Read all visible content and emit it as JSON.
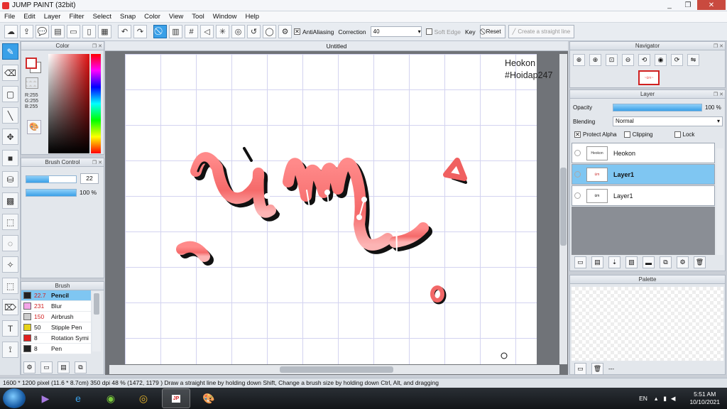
{
  "window": {
    "title": "JUMP PAINT (32bit)",
    "min": "_",
    "max": "❐",
    "close": "✕"
  },
  "menu": [
    "File",
    "Edit",
    "Layer",
    "Filter",
    "Select",
    "Snap",
    "Color",
    "View",
    "Tool",
    "Window",
    "Help"
  ],
  "toolbar": {
    "antialiasing_label": "AntiAliasing",
    "correction_label": "Correction",
    "correction_value": "40",
    "soft_edge_label": "Soft Edge",
    "key_label": "Key",
    "reset_label": "Reset",
    "straight_line_label": "Create a straight line"
  },
  "color_panel": {
    "title": "Color",
    "r": "R:255",
    "g": "G:255",
    "b": "B:255",
    "fg_color": "#d02a2a"
  },
  "brush_control": {
    "title": "Brush Control",
    "size": "22",
    "size_fill": 0.45,
    "opacity": "100 %",
    "opacity_fill": 1.0
  },
  "brush_panel": {
    "title": "Brush",
    "items": [
      {
        "size": "22.7",
        "name": "Pencil",
        "color": "#222222",
        "selected": true
      },
      {
        "size": "231",
        "name": "Blur",
        "color": "#f4a6e8",
        "selected": false
      },
      {
        "size": "150",
        "name": "Airbrush",
        "color": "#cccccc",
        "selected": false
      },
      {
        "size": "50",
        "name": "Stipple Pen",
        "color": "#e6d21a",
        "selected": false
      },
      {
        "size": "8",
        "name": "Rotation Symi",
        "color": "#e02020",
        "selected": false
      },
      {
        "size": "8",
        "name": "Pen",
        "color": "#222222",
        "selected": false
      }
    ]
  },
  "canvas": {
    "tab": "Untitled",
    "credit_line1": "Heokon",
    "credit_line2": "#Hoidap247"
  },
  "navigator": {
    "title": "Navigator"
  },
  "layer_panel": {
    "title": "Layer",
    "opacity_label": "Opacity",
    "opacity_value": "100 %",
    "opacity_fill": 1.0,
    "blending_label": "Blending",
    "blending_value": "Normal",
    "protect_alpha": "Protect Alpha",
    "clipping": "Clipping",
    "lock": "Lock",
    "layers": [
      {
        "name": "Heokon",
        "selected": false,
        "bold": false
      },
      {
        "name": "Layer1",
        "selected": true,
        "bold": true
      },
      {
        "name": "Layer1",
        "selected": false,
        "bold": false
      }
    ]
  },
  "palette_panel": {
    "title": "Palette",
    "footer": "---"
  },
  "status": "1600 * 1200 pixel  (11.6 * 8.7cm)  350 dpi  48 %  (1472, 1179 )  Draw a straight line by holding down Shift, Change a brush size by holding down Ctrl, Alt, and dragging",
  "taskbar": {
    "lang": "EN",
    "time": "5:51 AM",
    "date": "10/10/2021"
  }
}
